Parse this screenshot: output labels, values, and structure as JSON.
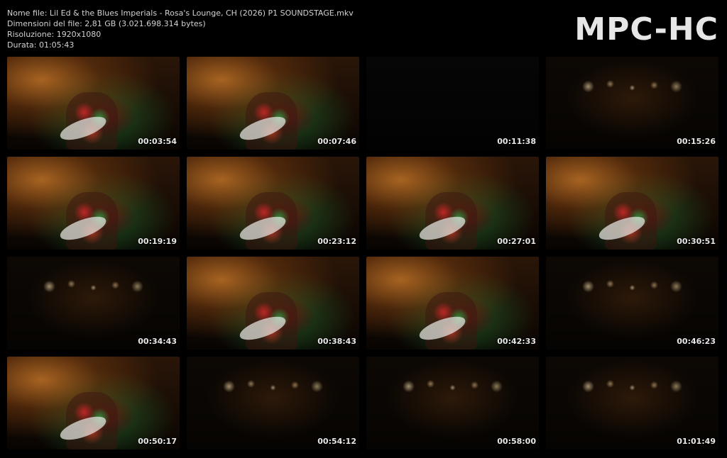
{
  "header": {
    "file_name": "Nome file: Lil Ed & the Blues Imperials - Rosa's Lounge, CH (2026) P1 SOUNDSTAGE.mkv",
    "file_size": "Dimensioni del file: 2,81 GB (3.021.698.314 bytes)",
    "resolution": "Risoluzione: 1920x1080",
    "duration": "Durata: 01:05:43"
  },
  "logo": "MPC-HC",
  "thumbnails": [
    {
      "time": "00:03:54",
      "style": "bright"
    },
    {
      "time": "00:07:46",
      "style": "bright"
    },
    {
      "time": "00:11:38",
      "style": "black"
    },
    {
      "time": "00:15:26",
      "style": "dark"
    },
    {
      "time": "00:19:19",
      "style": "bright"
    },
    {
      "time": "00:23:12",
      "style": "bright"
    },
    {
      "time": "00:27:01",
      "style": "bright"
    },
    {
      "time": "00:30:51",
      "style": "bright"
    },
    {
      "time": "00:34:43",
      "style": "dark"
    },
    {
      "time": "00:38:43",
      "style": "bright"
    },
    {
      "time": "00:42:33",
      "style": "bright"
    },
    {
      "time": "00:46:23",
      "style": "dark"
    },
    {
      "time": "00:50:17",
      "style": "bright"
    },
    {
      "time": "00:54:12",
      "style": "dark"
    },
    {
      "time": "00:58:00",
      "style": "dark"
    },
    {
      "time": "01:01:49",
      "style": "dark"
    }
  ]
}
